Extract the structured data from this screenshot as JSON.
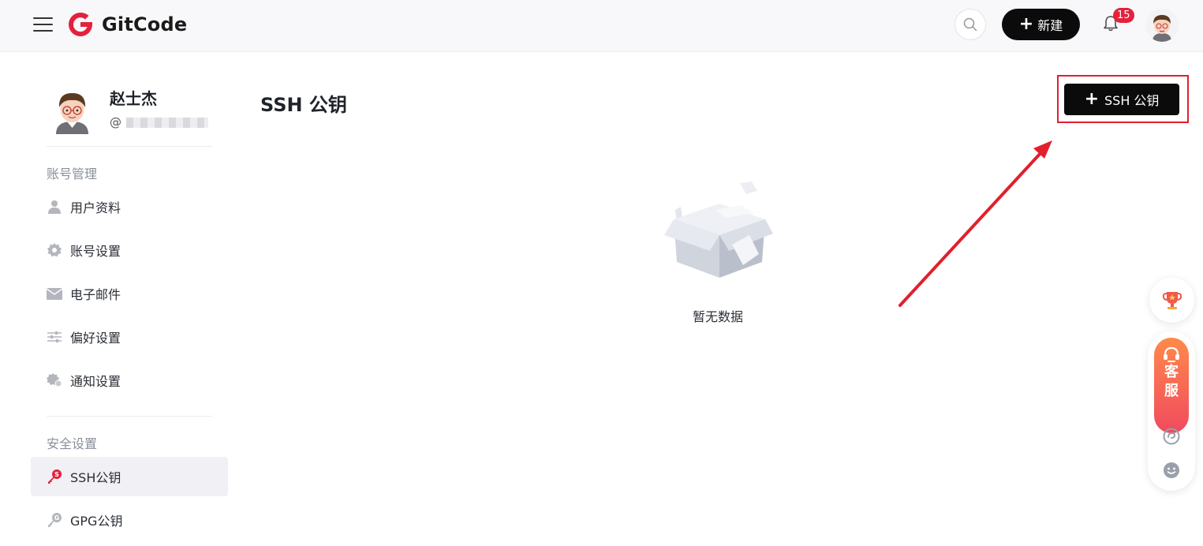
{
  "header": {
    "logo_text": "GitCode",
    "new_label": "新建",
    "notification_count": "15"
  },
  "sidebar": {
    "user_name": "赵士杰",
    "user_handle_prefix": "@",
    "section_account": "账号管理",
    "account_items": [
      {
        "label": "用户资料",
        "icon": "user-icon"
      },
      {
        "label": "账号设置",
        "icon": "gear-icon"
      },
      {
        "label": "电子邮件",
        "icon": "mail-icon"
      },
      {
        "label": "偏好设置",
        "icon": "sliders-icon"
      },
      {
        "label": "通知设置",
        "icon": "notification-gear-icon"
      }
    ],
    "section_security": "安全设置",
    "security_items": [
      {
        "label": "SSH公钥",
        "icon": "ssh-key-icon",
        "active": true
      },
      {
        "label": "GPG公钥",
        "icon": "gpg-key-icon",
        "active": false
      }
    ]
  },
  "main": {
    "title": "SSH 公钥",
    "add_button_label": "SSH 公钥",
    "empty_text": "暂无数据"
  },
  "float_widget": {
    "service_label_1": "客",
    "service_label_2": "服"
  },
  "colors": {
    "brand_red": "#e4213c",
    "highlight_red": "#e0202d",
    "button_black": "#0b0b0b",
    "active_bg": "#f0f0f5"
  }
}
